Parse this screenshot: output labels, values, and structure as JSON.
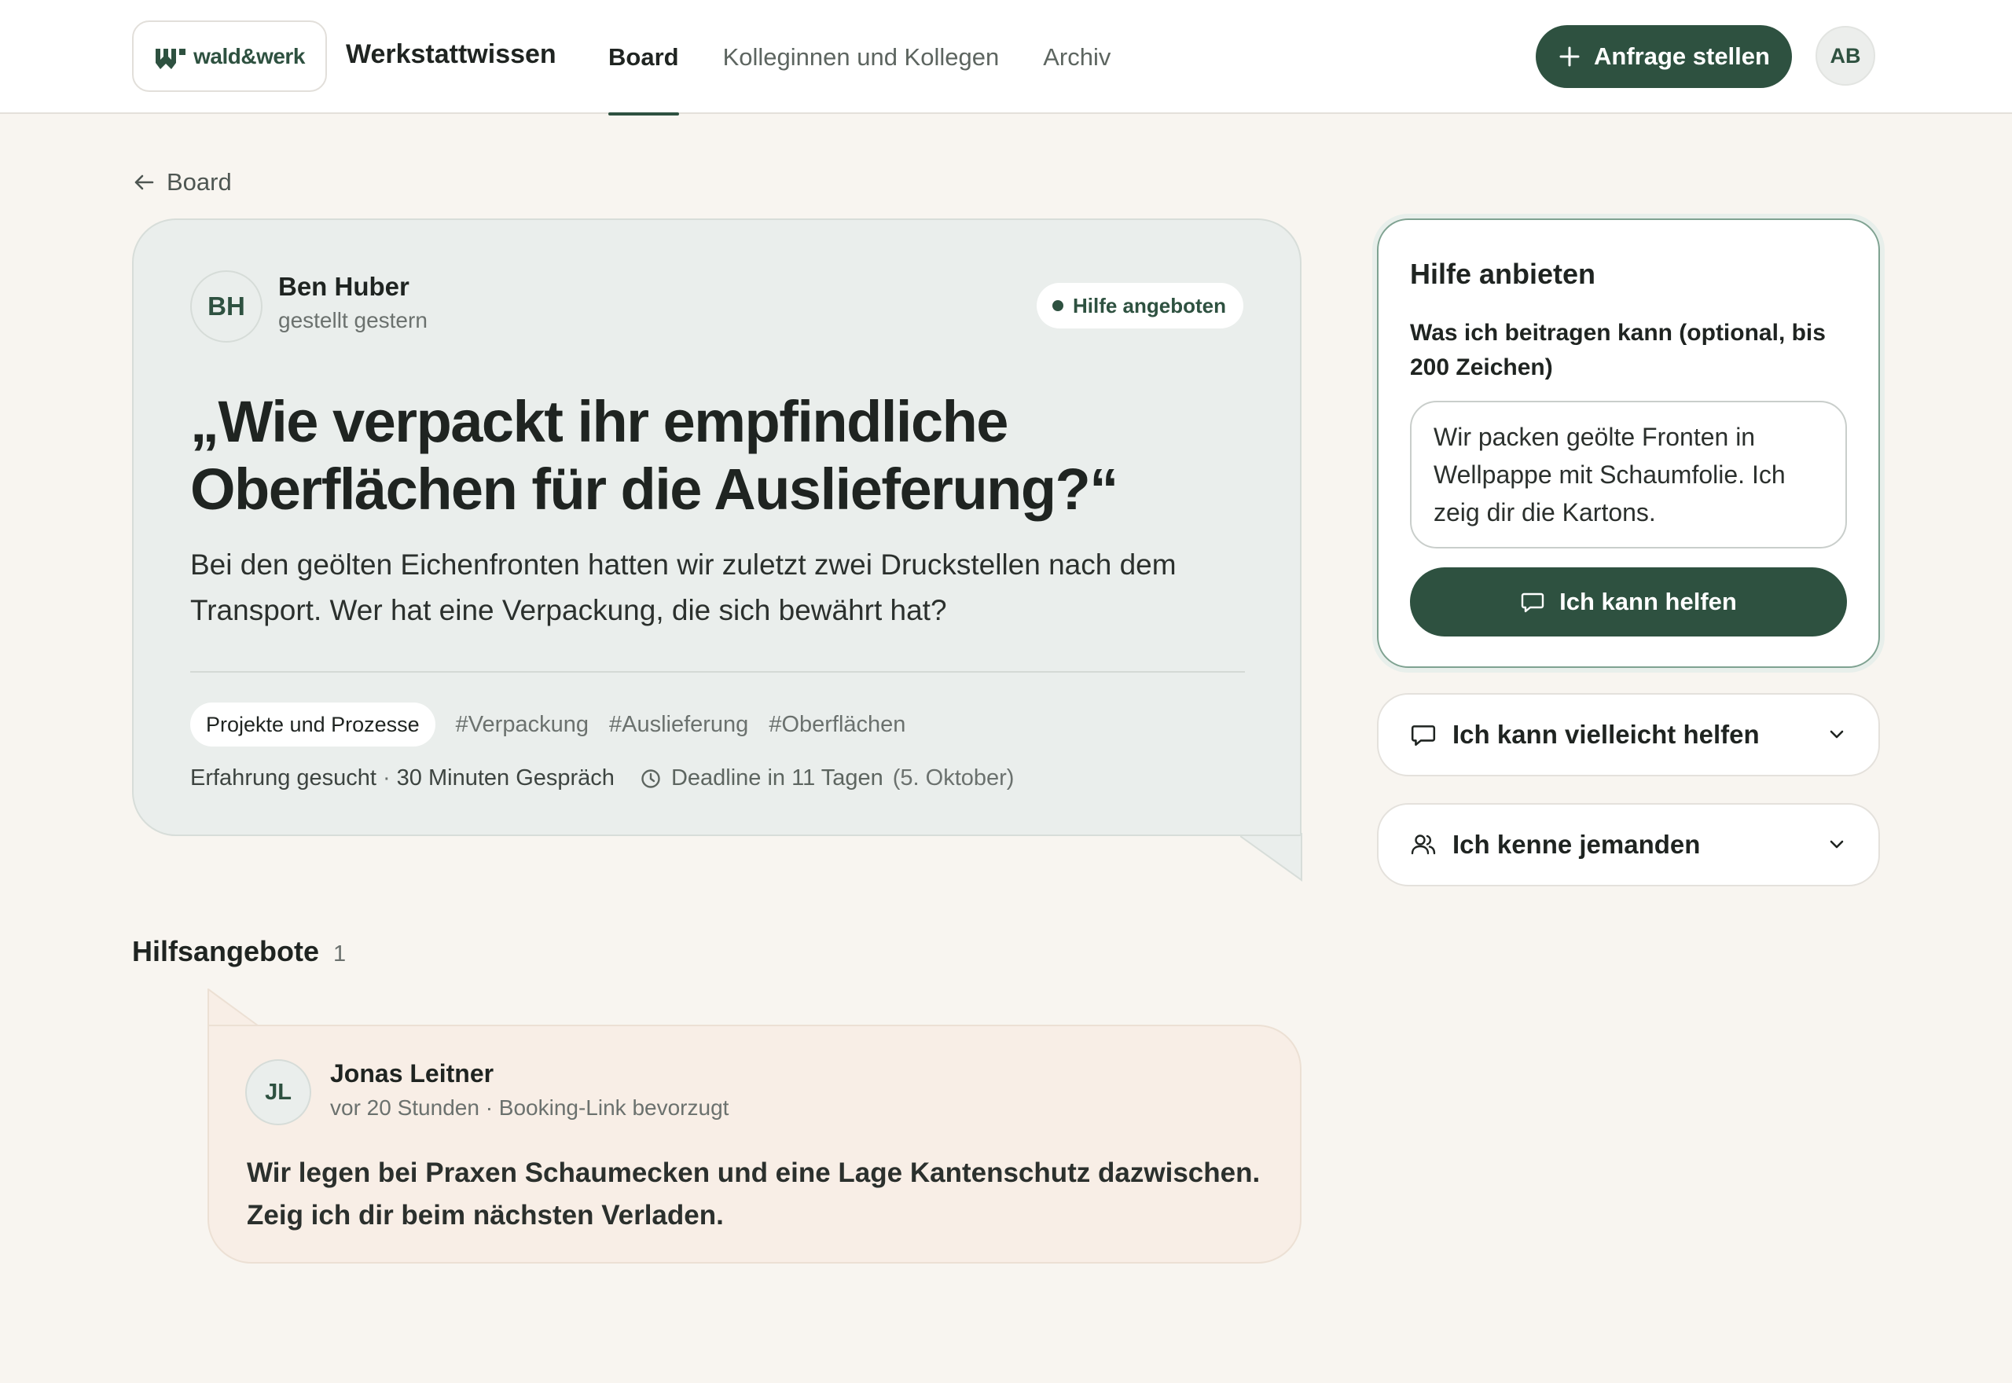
{
  "header": {
    "logo_text": "wald&werk",
    "app_name": "Werkstattwissen",
    "nav": [
      {
        "label": "Board",
        "active": true
      },
      {
        "label": "Kolleginnen und Kollegen",
        "active": false
      },
      {
        "label": "Archiv",
        "active": false
      }
    ],
    "cta_label": "Anfrage stellen",
    "user_initials": "AB"
  },
  "back_label": "Board",
  "question": {
    "author_initials": "BH",
    "author_name": "Ben Huber",
    "author_meta": "gestellt gestern",
    "status": "Hilfe angeboten",
    "title": "„Wie verpackt ihr empfindliche Oberflächen für die Auslieferung?“",
    "body": "Bei den geölten Eichenfronten hatten wir zuletzt zwei Druckstellen nach dem Transport. Wer hat eine Verpackung, die sich bewährt hat?",
    "category": "Projekte und Prozesse",
    "tags": [
      "#Verpackung",
      "#Auslieferung",
      "#Oberflächen"
    ],
    "meta_type": "Erfahrung gesucht",
    "meta_sep": "·",
    "meta_format": "30 Minuten Gespräch",
    "deadline": "Deadline in 11 Tagen",
    "deadline_date": "(5. Oktober)"
  },
  "help": {
    "title": "Hilfe anbieten",
    "label": "Was ich beitragen kann (optional, bis 200 Zeichen)",
    "textarea_value": "Wir packen geölte Fronten in Wellpappe mit Schaumfolie. Ich zeig dir die Kartons.",
    "submit_label": "Ich kann helfen",
    "accordion_maybe": "Ich kann vielleicht helfen",
    "accordion_someone": "Ich kenne jemanden"
  },
  "offers": {
    "title": "Hilfsangebote",
    "count": "1",
    "items": [
      {
        "initials": "JL",
        "name": "Jonas Leitner",
        "meta": "vor 20 Stunden · Booking-Link bevorzugt",
        "text": "Wir legen bei Praxen Schaumecken und eine Lage Kantenschutz dazwischen. Zeig ich dir beim nächsten Verladen."
      }
    ]
  },
  "colors": {
    "accent": "#2e5140",
    "page_bg": "#f8f5f0",
    "question_bg": "#eaeeec",
    "offer_bg": "#f8eee6"
  },
  "icons": [
    "logo-mark-icon",
    "plus-icon",
    "arrow-left-icon",
    "clock-icon",
    "chat-bubble-icon",
    "users-icon",
    "chevron-down-icon"
  ]
}
